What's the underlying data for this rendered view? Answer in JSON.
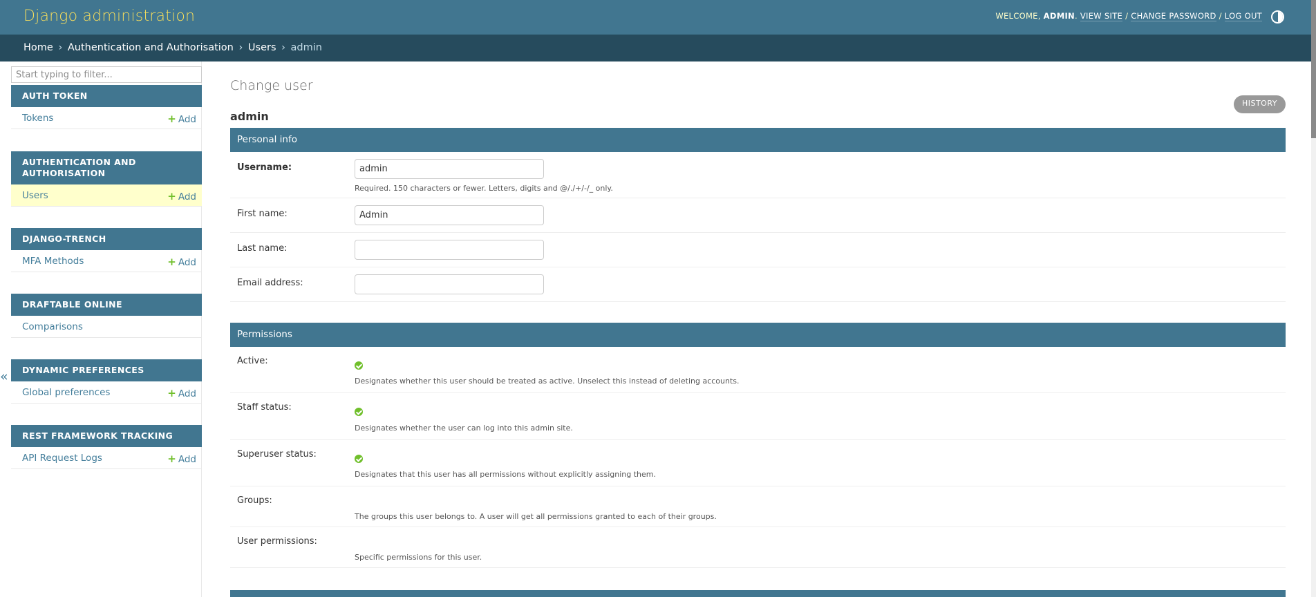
{
  "header": {
    "brand": "Django administration",
    "welcome": "WELCOME,",
    "username": "ADMIN",
    "view_site": "VIEW SITE",
    "change_password": "CHANGE PASSWORD",
    "log_out": "LOG OUT",
    "separator": "/"
  },
  "breadcrumbs": {
    "home": "Home",
    "app": "Authentication and Authorisation",
    "model": "Users",
    "current": "admin",
    "sep": "›"
  },
  "sidebar": {
    "filter_placeholder": "Start typing to filter...",
    "add_label": "Add",
    "toggle": "«",
    "modules": [
      {
        "caption": "AUTH TOKEN",
        "rows": [
          {
            "label": "Tokens",
            "add": true
          }
        ]
      },
      {
        "caption": "AUTHENTICATION AND AUTHORISATION",
        "rows": [
          {
            "label": "Users",
            "add": true,
            "current": true
          }
        ]
      },
      {
        "caption": "DJANGO-TRENCH",
        "rows": [
          {
            "label": "MFA Methods",
            "add": true
          }
        ]
      },
      {
        "caption": "DRAFTABLE ONLINE",
        "rows": [
          {
            "label": "Comparisons",
            "add": false
          }
        ]
      },
      {
        "caption": "DYNAMIC PREFERENCES",
        "rows": [
          {
            "label": "Global preferences",
            "add": true
          }
        ]
      },
      {
        "caption": "REST FRAMEWORK TRACKING",
        "rows": [
          {
            "label": "API Request Logs",
            "add": true
          }
        ]
      }
    ]
  },
  "content": {
    "title": "Change user",
    "object_name": "admin",
    "history_button": "HISTORY",
    "personal_info": {
      "caption": "Personal info",
      "username_label": "Username:",
      "username_value": "admin",
      "username_help": "Required. 150 characters or fewer. Letters, digits and @/./+/-/_ only.",
      "first_name_label": "First name:",
      "first_name_value": "Admin",
      "last_name_label": "Last name:",
      "last_name_value": "",
      "email_label": "Email address:",
      "email_value": ""
    },
    "permissions": {
      "caption": "Permissions",
      "active_label": "Active:",
      "active_help": "Designates whether this user should be treated as active. Unselect this instead of deleting accounts.",
      "staff_label": "Staff status:",
      "staff_help": "Designates whether the user can log into this admin site.",
      "superuser_label": "Superuser status:",
      "superuser_help": "Designates that this user has all permissions without explicitly assigning them.",
      "groups_label": "Groups:",
      "groups_help": "The groups this user belongs to. A user will get all permissions granted to each of their groups.",
      "user_permissions_label": "User permissions:",
      "user_permissions_help": "Specific permissions for this user."
    }
  },
  "colors": {
    "header_bg": "#417690",
    "breadcrumb_bg": "#264b5d",
    "brand": "#f5dd5d",
    "link": "#447e9b",
    "add_plus": "#70bf2b",
    "current_row": "#ffffcc"
  }
}
